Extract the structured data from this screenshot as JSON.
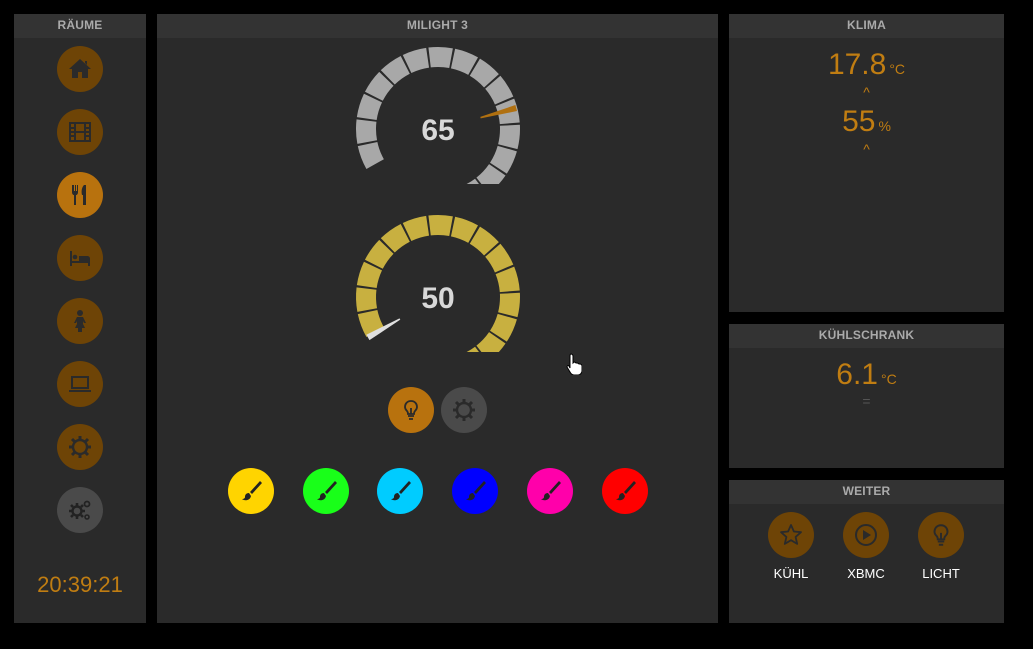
{
  "rooms": {
    "title": "RÄUME",
    "items": [
      {
        "name": "home",
        "icon": "home-icon",
        "active": false
      },
      {
        "name": "film",
        "icon": "film-icon",
        "active": false
      },
      {
        "name": "dining",
        "icon": "fork-knife-icon",
        "active": true
      },
      {
        "name": "bedroom",
        "icon": "bed-icon",
        "active": false
      },
      {
        "name": "child",
        "icon": "person-icon",
        "active": false
      },
      {
        "name": "office",
        "icon": "laptop-icon",
        "active": false
      },
      {
        "name": "settings",
        "icon": "gear-icon",
        "active": false
      },
      {
        "name": "system",
        "icon": "gears-icon",
        "active": false
      }
    ],
    "clock": "20:39:21"
  },
  "milight": {
    "title": "MILIGHT 3",
    "brightness": {
      "value": "65",
      "fraction": 0.65,
      "color": "#a8a8a8",
      "needle_color": "#b07010"
    },
    "white": {
      "value": "50",
      "fraction": 0.0,
      "color": "#c8b040",
      "needle_color": "#e0e0e0"
    },
    "modes": [
      {
        "icon": "bulb-icon",
        "color": "#b8720e"
      },
      {
        "icon": "gear-icon",
        "color": "#4a4a4a"
      }
    ],
    "colors": [
      {
        "name": "yellow",
        "hex": "#ffd400"
      },
      {
        "name": "green",
        "hex": "#19ff19"
      },
      {
        "name": "cyan",
        "hex": "#00ccff"
      },
      {
        "name": "blue",
        "hex": "#0000ff"
      },
      {
        "name": "magenta",
        "hex": "#ff00aa"
      },
      {
        "name": "red",
        "hex": "#ff0000"
      }
    ]
  },
  "klima": {
    "title": "KLIMA",
    "temperature": {
      "value": "17.8",
      "unit": "°C",
      "trend": "^"
    },
    "humidity": {
      "value": "55",
      "unit": "%",
      "trend": "^"
    }
  },
  "fridge": {
    "title": "KÜHLSCHRANK",
    "temperature": {
      "value": "6.1",
      "unit": "°C",
      "trend": "="
    }
  },
  "weiter": {
    "title": "WEITER",
    "items": [
      {
        "label": "KÜHL",
        "icon": "star-icon"
      },
      {
        "label": "XBMC",
        "icon": "play-icon"
      },
      {
        "label": "LICHT",
        "icon": "bulb-icon"
      }
    ]
  },
  "colors": {
    "accent": "#c07d12",
    "panel": "#2a2a2a",
    "header": "#333333"
  }
}
